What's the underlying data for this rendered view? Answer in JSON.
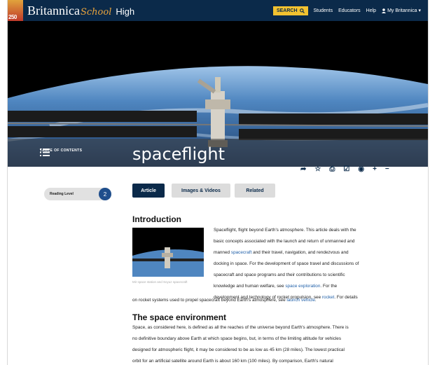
{
  "header": {
    "badge": "250",
    "brand_main": "Britannica",
    "brand_school": "School",
    "brand_level": "High",
    "search_label": "SEARCH",
    "nav": [
      "Students",
      "Educators",
      "Help"
    ],
    "user_label": "My Britannica"
  },
  "hero": {
    "toc_label": "TABLE OF CONTENTS",
    "title": "spaceflight"
  },
  "tools": [
    "share-icon",
    "star-icon",
    "print-icon",
    "checkbox-icon",
    "globe-icon",
    "plus-icon",
    "minus-icon"
  ],
  "reading": {
    "label": "Reading Level",
    "button": "2"
  },
  "tabs": {
    "article": "Article",
    "images": "Images & Videos",
    "related": "Related"
  },
  "intro": {
    "heading": "Introduction",
    "caption": "Mir space station and Soyuz spacecraft",
    "lines": [
      "Spaceflight, flight beyond Earth's atmosphere. This article deals with the",
      "basic concepts associated with the launch and return of unmanned and",
      [
        "manned ",
        "spacecraft",
        " and their travel, navigation, and rendezvous and"
      ],
      "docking in space. For the development of space travel and discussions of",
      "spacecraft and space programs and their contributions to scientific",
      [
        "knowledge and human welfare, see ",
        "space exploration",
        ". For the"
      ],
      [
        "development and technology of rocket propulsion, see ",
        "rocket",
        ". For details"
      ]
    ],
    "full_line": [
      "on rocket systems used to propel spacecraft beyond Earth's atmosphere, see ",
      "launch vehicle",
      "."
    ]
  },
  "space": {
    "heading": "The space environment",
    "lines": [
      "Space, as considered here, is defined as all the reaches of the universe beyond Earth's atmosphere. There is",
      "no definitive boundary above Earth at which space begins, but, in terms of the limiting altitude for vehicles",
      "designed for atmospheric flight, it may be considered to be as low as 45 km (28 miles). The lowest practical",
      "orbit for an artificial satellite around Earth is about 160 km (100 miles). By comparison, Earth's natural"
    ]
  },
  "colors": {
    "navy": "#0b2a4a",
    "search_yellow": "#f2c230",
    "link_blue": "#1f5fa8",
    "brand_orange": "#e8a33c"
  }
}
